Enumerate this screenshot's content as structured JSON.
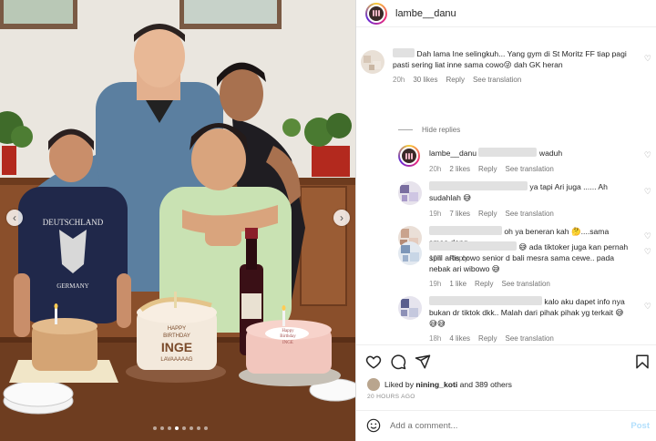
{
  "photo": {
    "shirt_text_top": "DEUTSCHLAND",
    "shirt_text_bottom": "GERMANY",
    "cake_mid_line1": "HAPPY",
    "cake_mid_line2": "BIRTHDAY",
    "cake_mid_line3": "INGE",
    "cake_mid_line4": "LAVAAAAAG",
    "cake_right_line1": "Happy",
    "cake_right_line2": "Birthday",
    "cake_right_line3": "INGE",
    "nav_prev_icon": "chevron-left-icon",
    "nav_next_icon": "chevron-right-icon",
    "carousel_dots": 8,
    "carousel_active_index": 3
  },
  "header": {
    "username": "lambe__danu"
  },
  "comments": [
    {
      "text": "Dah lama Ine selingkuh... Yang gym di St Moritz FF tiap pagi pasti sering liat inne sama cowo😜 dah GK heran",
      "time": "20h",
      "likes": "30 likes",
      "reply": "Reply",
      "translation": "See translation"
    }
  ],
  "hide_replies": "Hide replies",
  "replies": [
    {
      "user": "lambe__danu",
      "text": "waduh",
      "time": "20h",
      "likes": "2 likes",
      "reply": "Reply",
      "translation": "See translation"
    },
    {
      "text": "ya tapi Ari juga ...... Ah sudahlah 😅",
      "time": "19h",
      "likes": "7 likes",
      "reply": "Reply",
      "translation": "See translation"
    },
    {
      "text": "oh ya beneran kah 🤔....sama smaa dong",
      "time": "19h",
      "reply": "Reply"
    },
    {
      "text": "😅 ada tiktoker juga kan pernah spill artis cowo senior d bali mesra sama cewe.. pada nebak ari wibowo 😅",
      "time": "19h",
      "likes": "1 like",
      "reply": "Reply",
      "translation": "See translation"
    },
    {
      "text": "kalo aku dapet info nya bukan dr tiktok dkk.. Malah dari pihak pihak yg terkait 😅😅😅",
      "time": "18h",
      "likes": "4 likes",
      "reply": "Reply",
      "translation": "See translation"
    }
  ],
  "likes": {
    "prefix": "Liked by",
    "user": "nining_koti",
    "suffix": "and 389 others"
  },
  "timestamp": "20 HOURS AGO",
  "add_comment": {
    "placeholder": "Add a comment...",
    "post_label": "Post"
  },
  "colors": {
    "link_blue": "#b2dffc",
    "meta_grey": "#8e8e8e",
    "text": "#262626"
  }
}
